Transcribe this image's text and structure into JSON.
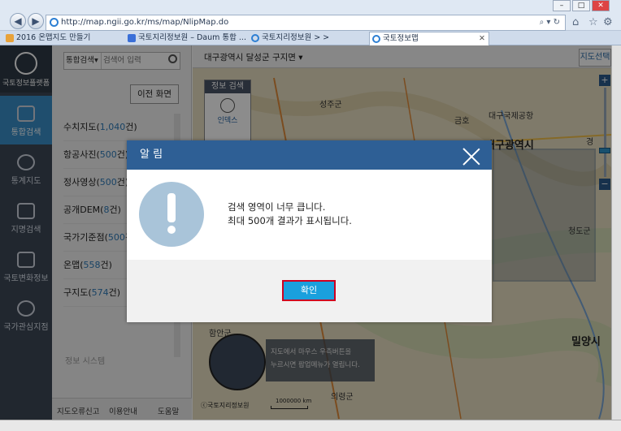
{
  "browser": {
    "url": "http://map.ngii.go.kr/ms/map/NlipMap.do",
    "tabs": [
      {
        "label": "2016 온맵지도 만들기"
      },
      {
        "label": "국토지리정보원 – Daum 통합 ..."
      },
      {
        "label": "국토지리정보원 > >"
      },
      {
        "label": "국토정보맵"
      }
    ]
  },
  "leftnav": {
    "logo_label": "국토정보플랫폼",
    "items": [
      {
        "label": "통합검색"
      },
      {
        "label": "통계지도"
      },
      {
        "label": "지명검색"
      },
      {
        "label": "국토변화정보"
      },
      {
        "label": "국가관심지점"
      }
    ]
  },
  "panel": {
    "search_type": "통합검색",
    "search_placeholder": "검색어 입력",
    "prev_button": "이전 화면",
    "results": [
      {
        "label": "수치지도",
        "count": "1,040",
        "suffix": "건)"
      },
      {
        "label": "항공사진",
        "count": "500",
        "suffix": "건)"
      },
      {
        "label": "정사영상",
        "count": "500",
        "suffix": "건)"
      },
      {
        "label": "공개DEM",
        "count": "8",
        "suffix": "건)"
      },
      {
        "label": "국가기준점",
        "count": "500",
        "suffix": "건"
      },
      {
        "label": "온맵",
        "count": "558",
        "suffix": "건)"
      },
      {
        "label": "구지도",
        "count": "574",
        "suffix": "건)"
      }
    ],
    "faded_text": "정보 시스템",
    "footer": [
      "지도오류신고",
      "이용안내",
      "도움말"
    ]
  },
  "map": {
    "location": "대구광역시 달성군 구지면",
    "map_tab": "지도선택",
    "info_box_title": "정보 검색",
    "info_box_item": "인덱스",
    "labels": {
      "city": "대구광역시",
      "seongju": "성주군",
      "airport": "대구국제공항",
      "cheongdo": "청도군",
      "miryang": "밀양시",
      "uiryeong": "의령군",
      "haman": "함안군",
      "geumho": "금호",
      "gyeong": "경"
    },
    "tooltip": [
      "지도에서 마우스 우측버튼을",
      "누르시면 팝업메뉴가 열립니다."
    ],
    "copyright": "ⓒ국토지리정보원",
    "scale": "1000000 km"
  },
  "modal": {
    "title": "알 림",
    "message_1": "검색 영역이 너무 큽니다.",
    "message_2": "최대 500개 결과가 표시됩니다.",
    "ok_label": "확인"
  }
}
